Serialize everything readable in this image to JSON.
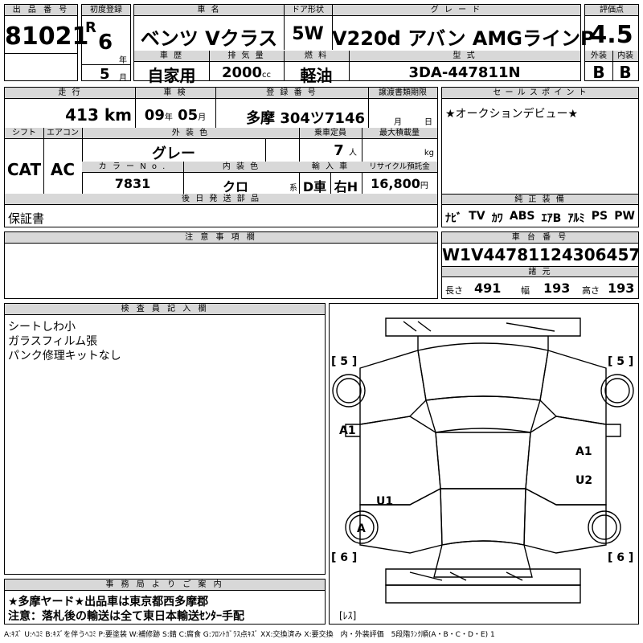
{
  "lot": {
    "label": "出 品 番 号",
    "value": "81021"
  },
  "first_reg": {
    "label": "初度登録",
    "era": "R",
    "year": "6",
    "year_unit": "年",
    "month": "5",
    "month_unit": "月"
  },
  "car_name": {
    "label": "車 名",
    "value": "ベンツ Vクラス"
  },
  "door": {
    "label": "ドア形状",
    "value": "5W"
  },
  "grade": {
    "label": "グ レ ー ド",
    "value": "V220d アバン AMGラインP"
  },
  "score": {
    "label": "評価点",
    "value": "4.5"
  },
  "history": {
    "label": "車 歴",
    "value": "自家用"
  },
  "displacement": {
    "label": "排 気 量",
    "value": "2000",
    "unit": "cc"
  },
  "fuel": {
    "label": "燃 料",
    "value": "軽油"
  },
  "model": {
    "label": "型 式",
    "value": "3DA-447811N"
  },
  "ext_grade": {
    "label": "外装",
    "value": "B"
  },
  "int_grade": {
    "label": "内装",
    "value": "B"
  },
  "mileage": {
    "label": "走 行",
    "value": "413",
    "unit": "km"
  },
  "inspection": {
    "label": "車 検",
    "year": "09",
    "year_unit": "年",
    "month": "05",
    "month_unit": "月"
  },
  "reg_no": {
    "label": "登 録 番 号",
    "value": "多摩 304ツ7146"
  },
  "transfer": {
    "label": "譲渡書類期限",
    "month_unit": "月",
    "day_unit": "日"
  },
  "shift": {
    "label": "シフト",
    "value": "CAT"
  },
  "aircon": {
    "label": "エアコン",
    "value": "AC"
  },
  "ext_color": {
    "label": "外 装 色",
    "value": "グレー"
  },
  "capacity": {
    "label": "乗車定員",
    "value": "7",
    "unit": "人"
  },
  "max_load": {
    "label": "最大積載量",
    "unit": "kg"
  },
  "color_no": {
    "label": "カ ラ ー N o .",
    "value": "7831"
  },
  "int_color": {
    "label": "内 装 色",
    "value": "クロ",
    "unit": "系"
  },
  "import": {
    "label": "輸 入 車",
    "value1": "D車",
    "value2": "右H"
  },
  "recycle": {
    "label": "リサイクル預託金",
    "value": "16,800",
    "unit": "円"
  },
  "later_parts": {
    "label": "後 日 発 送 部 品",
    "value": "保証書"
  },
  "selling_points": {
    "label": "セ ー ル ス ポ イ ン ト",
    "value": "★オークションデビュー★"
  },
  "equipment": {
    "label": "純 正 装 備",
    "items": [
      "ﾅﾋﾞ",
      "TV",
      "ｶﾜ",
      "ABS",
      "ｴｱB",
      "ｱﾙﾐ",
      "PS",
      "PW"
    ]
  },
  "notes": {
    "label": "注 意 事 項 欄"
  },
  "chassis": {
    "label": "車 台 番 号",
    "value": "W1V44781124306457"
  },
  "specs": {
    "label": "諸 元",
    "length_label": "長さ",
    "length": "491",
    "width_label": "幅",
    "width": "193",
    "height_label": "高さ",
    "height": "193"
  },
  "inspector": {
    "label": "検 査 員 記 入 欄",
    "lines": [
      "シートしわ小",
      "ガラスフィルム張",
      "パンク修理キットなし"
    ]
  },
  "diagram": {
    "marks": [
      "[ 5 ]",
      "[ 5 ]",
      "A1",
      "A1",
      "U1",
      "U2",
      "A",
      "[ 6 ]",
      "[ 6 ]",
      "[ﾚｽ]"
    ]
  },
  "office": {
    "label": "事 務 局 よ り ご 案 内",
    "lines": [
      "★多摩ヤード★出品車は東京都西多摩郡",
      "注意：落札後の輸送は全て東日本輸送ｾﾝﾀｰ手配"
    ]
  },
  "legend": "A:ｷｽﾞ U:ﾍｺﾐ B:ｷｽﾞを伴うﾍｺﾐ P:要塗装 W:補修跡 S:錆 C:腐食 G:ﾌﾛﾝﾄｶﾞﾗｽ点ｷｽﾞ XX:交換済み X:要交換　内・外装評価　5段階ﾗﾝｸ順(A・B・C・D・E) 1"
}
